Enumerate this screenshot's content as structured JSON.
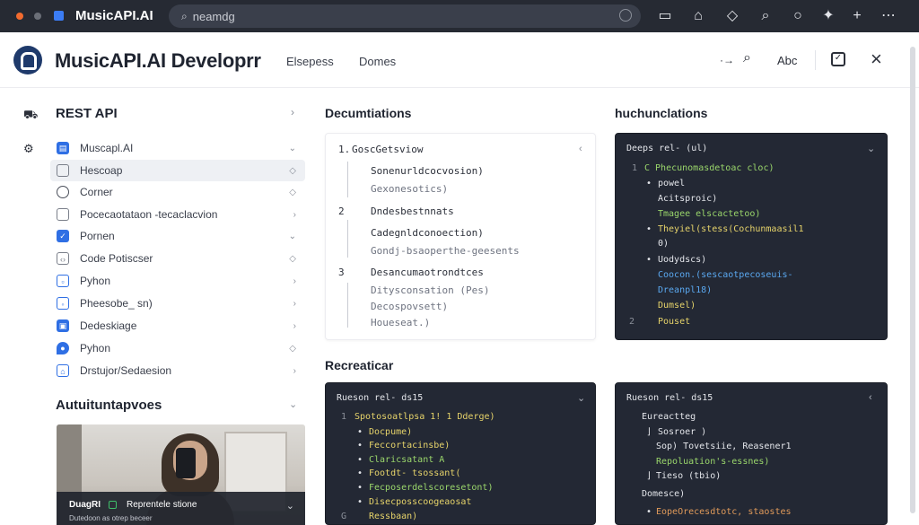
{
  "browser": {
    "tab_title": "MusicAPI.AI",
    "url_text": "neamdg"
  },
  "header": {
    "title": "MusicAPI.AI Developrr",
    "links": [
      "Elsepess",
      "Domes"
    ],
    "right_text": "Abc"
  },
  "sidebar": {
    "title": "REST API",
    "items": [
      {
        "label": "Muscapl.AI",
        "icon": "doc-icon"
      },
      {
        "label": "Hescoap",
        "icon": "square-icon"
      },
      {
        "label": "Corner",
        "icon": "circle-icon"
      },
      {
        "label": "Pocecaotataon -tecaclacvion",
        "icon": "square-icon"
      },
      {
        "label": "Pornen",
        "icon": "check-icon"
      },
      {
        "label": "Code Potiscser",
        "icon": "code-icon"
      },
      {
        "label": "Pyhon",
        "icon": "code-icon"
      },
      {
        "label": "Pheesobe_ sn)",
        "icon": "circle-icon"
      },
      {
        "label": "Dedeskiage",
        "icon": "settings-icon"
      },
      {
        "label": "Pyhon",
        "icon": "shield-icon"
      },
      {
        "label": "Drstujor/Sedaesion",
        "icon": "lock-icon"
      }
    ],
    "section2_title": "Autuituntapvoes",
    "photo_caption": {
      "line1_a": "DuagRI",
      "line1_b": "Reprentele stione",
      "line2": "Dutedoon as otrep beceer"
    }
  },
  "docs": {
    "heading": "Decumtiations",
    "lines": [
      {
        "num": "1.",
        "text": "GoscGetsviow"
      },
      {
        "num": "",
        "text": "Sonenurldcocvosion)"
      },
      {
        "num": "",
        "text": "Gexonesotics)"
      },
      {
        "num": "2",
        "text": "Dndesbestnnats"
      },
      {
        "num": "",
        "text": "Cadegnldconoection)"
      },
      {
        "num": "",
        "text": "Gondj-bsaoperthe-geesents"
      },
      {
        "num": "3",
        "text": "Desancumaotrondtces"
      },
      {
        "num": "",
        "text": "Ditysconsation (Pes)"
      },
      {
        "num": "",
        "text": "Decospovsett)"
      },
      {
        "num": "",
        "text": "Houeseat.)"
      }
    ]
  },
  "examples": {
    "heading": "huchunclations",
    "header": "Deeps rel- (ul)",
    "lines": [
      {
        "num": "1",
        "text": "C Phecunomasdetoac cloc)"
      },
      {
        "num": "",
        "text": "powel"
      },
      {
        "num": "",
        "text": "Acitsproic)"
      },
      {
        "num": "",
        "text": "Tmagee elscactetoo)"
      },
      {
        "num": "",
        "text": "Theyiel(stess(Cochunmaasil1"
      },
      {
        "num": "",
        "text": "0)"
      },
      {
        "num": "",
        "text": "Uodydscs)"
      },
      {
        "num": "",
        "text": "Coocon.(sescaotpecoseuis-"
      },
      {
        "num": "",
        "text": "Dreanpl18)"
      },
      {
        "num": "",
        "text": "Dumsel)"
      },
      {
        "num": "2",
        "text": "Pouset"
      }
    ]
  },
  "reference": {
    "heading": "Recreaticar",
    "panel1": {
      "header": "Rueson rel- ds15",
      "lines": [
        {
          "num": "1",
          "text": "Spotosoatlpsa 1! 1 Dderge)"
        },
        {
          "num": "",
          "text": "Docpume)"
        },
        {
          "num": "",
          "text": "Feccortacinsbe)"
        },
        {
          "num": "",
          "text": "Claricsatant A"
        },
        {
          "num": "",
          "text": "Footdt- tsossant("
        },
        {
          "num": "",
          "text": "Fecposerdelscoresetont)"
        },
        {
          "num": "",
          "text": "Disecposscoogeaosat"
        },
        {
          "num": "G",
          "text": "Ressbaan)"
        }
      ]
    },
    "panel2": {
      "header": "Rueson rel- ds15",
      "lines": [
        {
          "num": "",
          "text": "Eureactteg"
        },
        {
          "num": "",
          "text": "Sosroer )"
        },
        {
          "num": "",
          "text": "Sop) Tovetsiie, Reasener1"
        },
        {
          "num": "",
          "text": "Repoluation's-essnes)"
        },
        {
          "num": "",
          "text": "Tieso (tbio)"
        },
        {
          "num": "",
          "text": "Domesce)"
        },
        {
          "num": "",
          "text": "EopeOrecesdtotc, staostes"
        }
      ]
    }
  },
  "colors": {
    "accent": "#2f6fe4",
    "code_bg": "#232834",
    "code_green": "#9ad66b",
    "code_yellow": "#e6d36a",
    "code_blue": "#5aa8f0"
  }
}
